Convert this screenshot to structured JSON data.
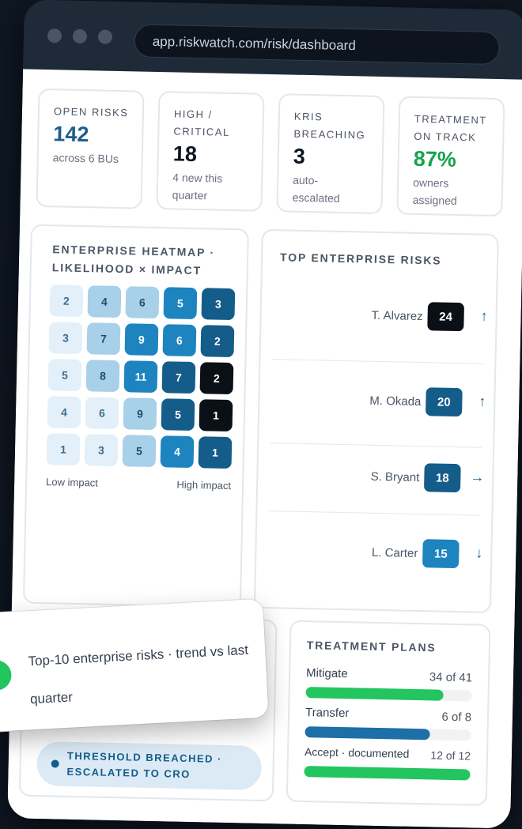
{
  "browser": {
    "url": "app.riskwatch.com/risk/dashboard"
  },
  "kpis": [
    {
      "label": "OPEN RISKS",
      "value": "142",
      "sub": "across 6 BUs",
      "value_color": "#1d5f8c"
    },
    {
      "label": "HIGH / CRITICAL",
      "value": "18",
      "sub": "4 new this quarter",
      "value_color": "#0f1722"
    },
    {
      "label": "KRIS BREACHING",
      "value": "3",
      "sub": "auto-escalated",
      "value_color": "#0f1722"
    },
    {
      "label": "TREATMENT ON TRACK",
      "value": "87%",
      "sub": "owners assigned",
      "value_color": "#16a34a"
    }
  ],
  "heatmap": {
    "title": "ENTERPRISE HEATMAP · LIKELIHOOD × IMPACT",
    "rows": [
      [
        "2",
        "4",
        "6",
        "5",
        "3"
      ],
      [
        "3",
        "7",
        "9",
        "6",
        "2"
      ],
      [
        "5",
        "8",
        "11",
        "7",
        "2"
      ],
      [
        "4",
        "6",
        "9",
        "5",
        "1"
      ],
      [
        "1",
        "3",
        "5",
        "4",
        "1"
      ]
    ],
    "levels": [
      [
        1,
        2,
        2,
        3,
        4
      ],
      [
        1,
        2,
        3,
        3,
        4
      ],
      [
        1,
        2,
        3,
        4,
        5
      ],
      [
        1,
        1,
        2,
        4,
        5
      ],
      [
        1,
        1,
        2,
        3,
        4
      ]
    ],
    "low_label": "Low impact",
    "high_label": "High impact"
  },
  "top_risks": {
    "title": "TOP ENTERPRISE RISKS",
    "items": [
      {
        "owner": "T. Alvarez",
        "score": "24",
        "trend": "↑",
        "color": "#0b0f16"
      },
      {
        "owner": "M. Okada",
        "score": "20",
        "trend": "↑",
        "color": "#145c8a"
      },
      {
        "owner": "S. Bryant",
        "score": "18",
        "trend": "→",
        "color": "#145c8a"
      },
      {
        "owner": "L. Carter",
        "score": "15",
        "trend": "↓",
        "color": "#1d84c0"
      }
    ]
  },
  "treatment": {
    "title": "TREATMENT PLANS",
    "items": [
      {
        "label": "Mitigate",
        "count": "34 of 41",
        "fraction": 0.83,
        "color": "#22c55e"
      },
      {
        "label": "Transfer",
        "count": "6 of 8",
        "fraction": 0.75,
        "color": "#1d6fa8"
      },
      {
        "label": "Accept · documented",
        "count": "12 of 12",
        "fraction": 1.0,
        "color": "#22c55e"
      }
    ]
  },
  "status_pill": {
    "text": "THRESHOLD BREACHED · ESCALATED TO CRO"
  },
  "toast": {
    "text": "Top-10 enterprise risks · trend vs last quarter",
    "icon": "check-icon"
  }
}
